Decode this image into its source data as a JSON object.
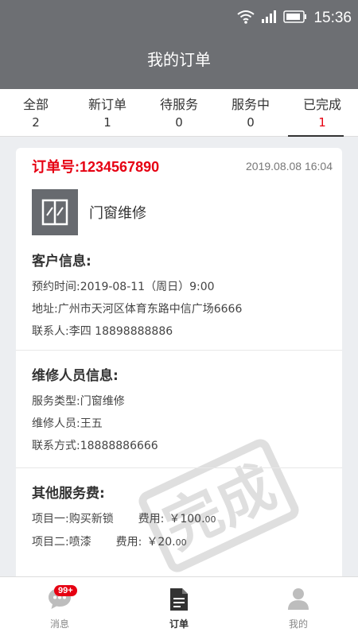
{
  "status": {
    "time": "15:36"
  },
  "header": {
    "title": "我的订单"
  },
  "tabs": [
    {
      "label": "全部",
      "count": "2"
    },
    {
      "label": "新订单",
      "count": "1"
    },
    {
      "label": "待服务",
      "count": "0"
    },
    {
      "label": "服务中",
      "count": "0"
    },
    {
      "label": "已完成",
      "count": "1"
    }
  ],
  "order": {
    "number": "订单号:1234567890",
    "datetime": "2019.08.08  16:04",
    "service_name": "门窗维修",
    "customer": {
      "title": "客户信息:",
      "appointment": "预约时间:2019-08-11（周日）9:00",
      "address": "地址:广州市天河区体育东路中信广场6666",
      "contact": "联系人:李四   18898888886"
    },
    "worker": {
      "title": "维修人员信息:",
      "service_type": "服务类型:门窗维修",
      "person": "维修人员:王五",
      "phone": "联系方式:18888886666"
    },
    "fees": {
      "title": "其他服务费:",
      "items": [
        {
          "name": "项目一:购买新锁",
          "fee_label": "费用:",
          "amount": "￥100.",
          "decimals": "00"
        },
        {
          "name": "项目二:喷漆",
          "fee_label": "费用:",
          "amount": "￥20.",
          "decimals": "00"
        }
      ]
    },
    "stamp_text": "完成"
  },
  "tabbar": {
    "messages_label": "消息",
    "messages_badge": "99+",
    "orders_label": "订单",
    "mine_label": "我的"
  },
  "colors": {
    "accent": "#e60012",
    "header": "#6d6f73"
  }
}
